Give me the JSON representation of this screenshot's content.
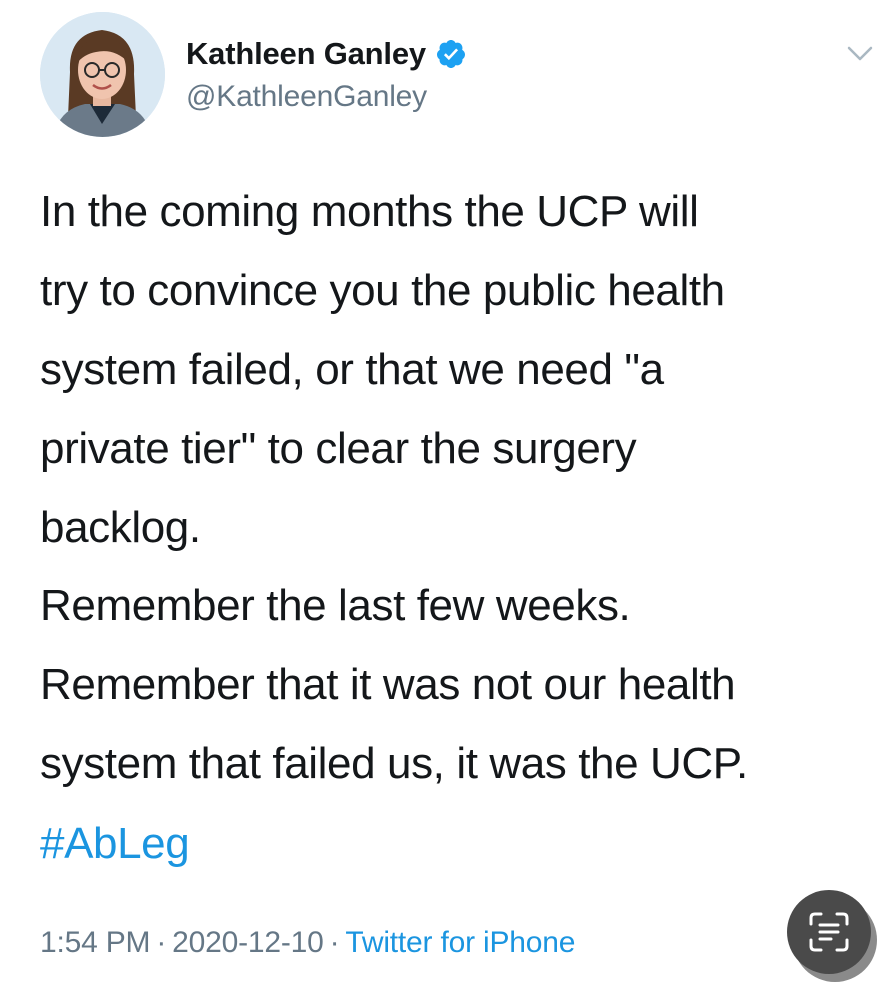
{
  "tweet": {
    "author": {
      "display_name": "Kathleen Ganley",
      "handle": "@KathleenGanley",
      "verified": true
    },
    "paragraph_1": "In the coming months the UCP will\ntry to convince you the public health\nsystem failed, or that we need \"a\nprivate tier\" to clear the surgery\nbacklog.",
    "paragraph_2": "Remember the last few weeks.\nRemember that it was not our health\nsystem that failed us, it was the UCP.",
    "hashtag": "#AbLeg",
    "time": "1:54 PM",
    "date": "2020-12-10",
    "source": "Twitter for iPhone",
    "separator": "·"
  },
  "colors": {
    "text": "#14171a",
    "secondary": "#657786",
    "link": "#1b95e0",
    "verified_badge": "#1da1f2"
  },
  "icons": {
    "verified": "verified-badge-icon",
    "menu": "chevron-down-icon",
    "ocr": "live-text-scan-icon"
  }
}
